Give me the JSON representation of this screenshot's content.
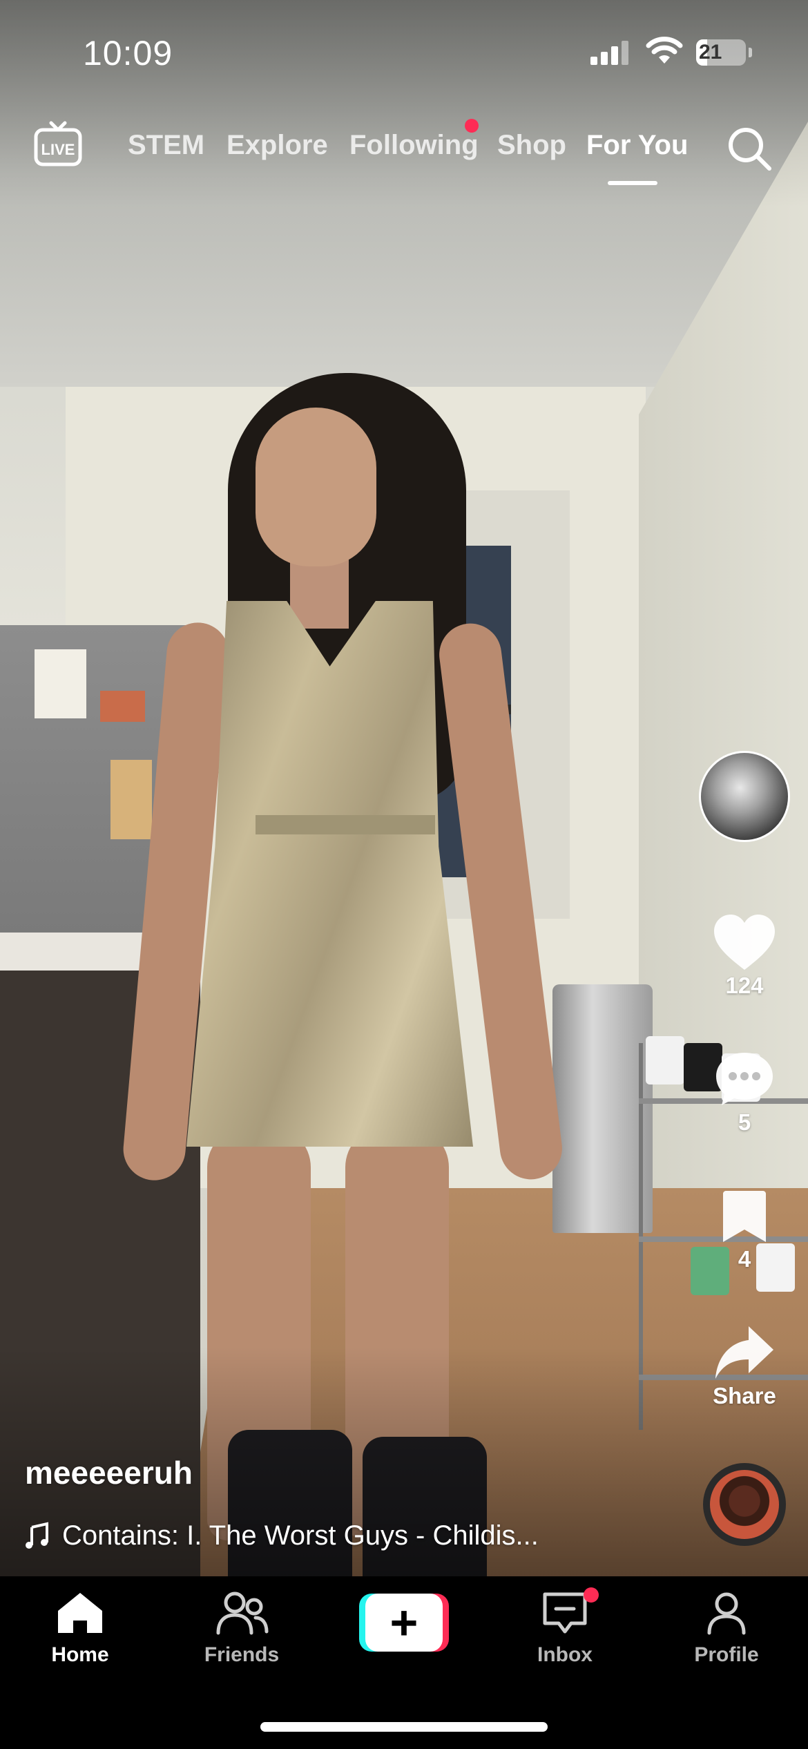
{
  "status_bar": {
    "time": "10:09",
    "battery": "21"
  },
  "top_nav": {
    "live_label": "LIVE",
    "tabs": [
      {
        "label": "STEM"
      },
      {
        "label": "Explore"
      },
      {
        "label": "Following",
        "has_dot": true
      },
      {
        "label": "Shop"
      },
      {
        "label": "For You",
        "active": true
      }
    ]
  },
  "actions": {
    "likes": "124",
    "comments": "5",
    "saves": "4",
    "share_label": "Share"
  },
  "post": {
    "username": "meeeeeruh",
    "music": "Contains: I. The Worst Guys - Childis..."
  },
  "bottom_nav": {
    "items": [
      {
        "label": "Home",
        "active": true
      },
      {
        "label": "Friends"
      },
      {
        "label": "Inbox",
        "has_dot": true
      },
      {
        "label": "Profile"
      }
    ]
  },
  "colors": {
    "accent_red": "#fe2c55",
    "accent_cyan": "#25f4ee"
  }
}
